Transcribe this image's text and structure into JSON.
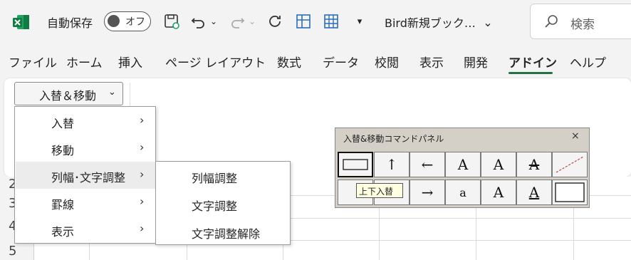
{
  "titlebar": {
    "autosave_label": "自動保存",
    "autosave_state": "オフ",
    "workbook_name": "Bird新規ブック…",
    "search_placeholder": "検索"
  },
  "tabs": [
    "ファイル",
    "ホーム",
    "挿入",
    "ページ レイアウト",
    "数式",
    "データ",
    "校閲",
    "表示",
    "開発",
    "アドイン",
    "ヘルプ"
  ],
  "active_tab": "アドイン",
  "ribbon": {
    "dropdown_label": "入替＆移動"
  },
  "menu": {
    "items": [
      {
        "label": "入替"
      },
      {
        "label": "移動"
      },
      {
        "label": "列幅･文字調整"
      },
      {
        "label": "罫線"
      },
      {
        "label": "表示"
      }
    ],
    "highlighted": "列幅･文字調整"
  },
  "submenu": {
    "items": [
      {
        "label": "列幅調整"
      },
      {
        "label": "文字調整"
      },
      {
        "label": "文字調整解除"
      }
    ]
  },
  "panel": {
    "title": "入替&移動コマンドパネル",
    "close": "×",
    "tooltip": "上下入替",
    "row1": [
      "",
      "↑",
      "←",
      "A",
      "A",
      "A",
      ""
    ],
    "row2": [
      "",
      "",
      "→",
      "a",
      "A",
      "A",
      ""
    ]
  },
  "grid": {
    "row_numbers": [
      "2",
      "3",
      "4",
      "5"
    ]
  },
  "colors": {
    "accent": "#217346",
    "excel_green": "#107c41"
  }
}
